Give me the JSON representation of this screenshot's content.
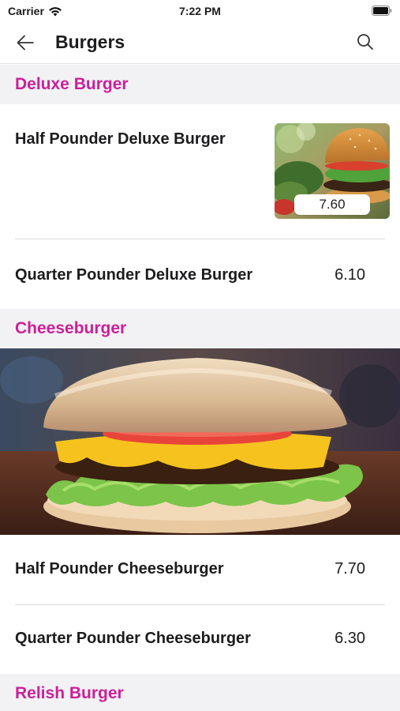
{
  "status_bar": {
    "carrier": "Carrier",
    "time": "7:22 PM"
  },
  "nav": {
    "title": "Burgers",
    "back_icon": "arrow-left-icon",
    "search_icon": "search-icon"
  },
  "sections": [
    {
      "title": "Deluxe Burger",
      "items": [
        {
          "name": "Half Pounder Deluxe Burger",
          "price": "7.60"
        },
        {
          "name": "Quarter Pounder Deluxe Burger",
          "price": "6.10"
        }
      ]
    },
    {
      "title": "Cheeseburger",
      "items": [
        {
          "name": "Half Pounder Cheeseburger",
          "price": "7.70"
        },
        {
          "name": "Quarter Pounder Cheeseburger",
          "price": "6.30"
        }
      ]
    },
    {
      "title": "Relish Burger",
      "items": []
    }
  ],
  "colors": {
    "accent": "#cc1f9a",
    "section_bg": "#f2f2f4",
    "text": "#1c1c1e"
  }
}
